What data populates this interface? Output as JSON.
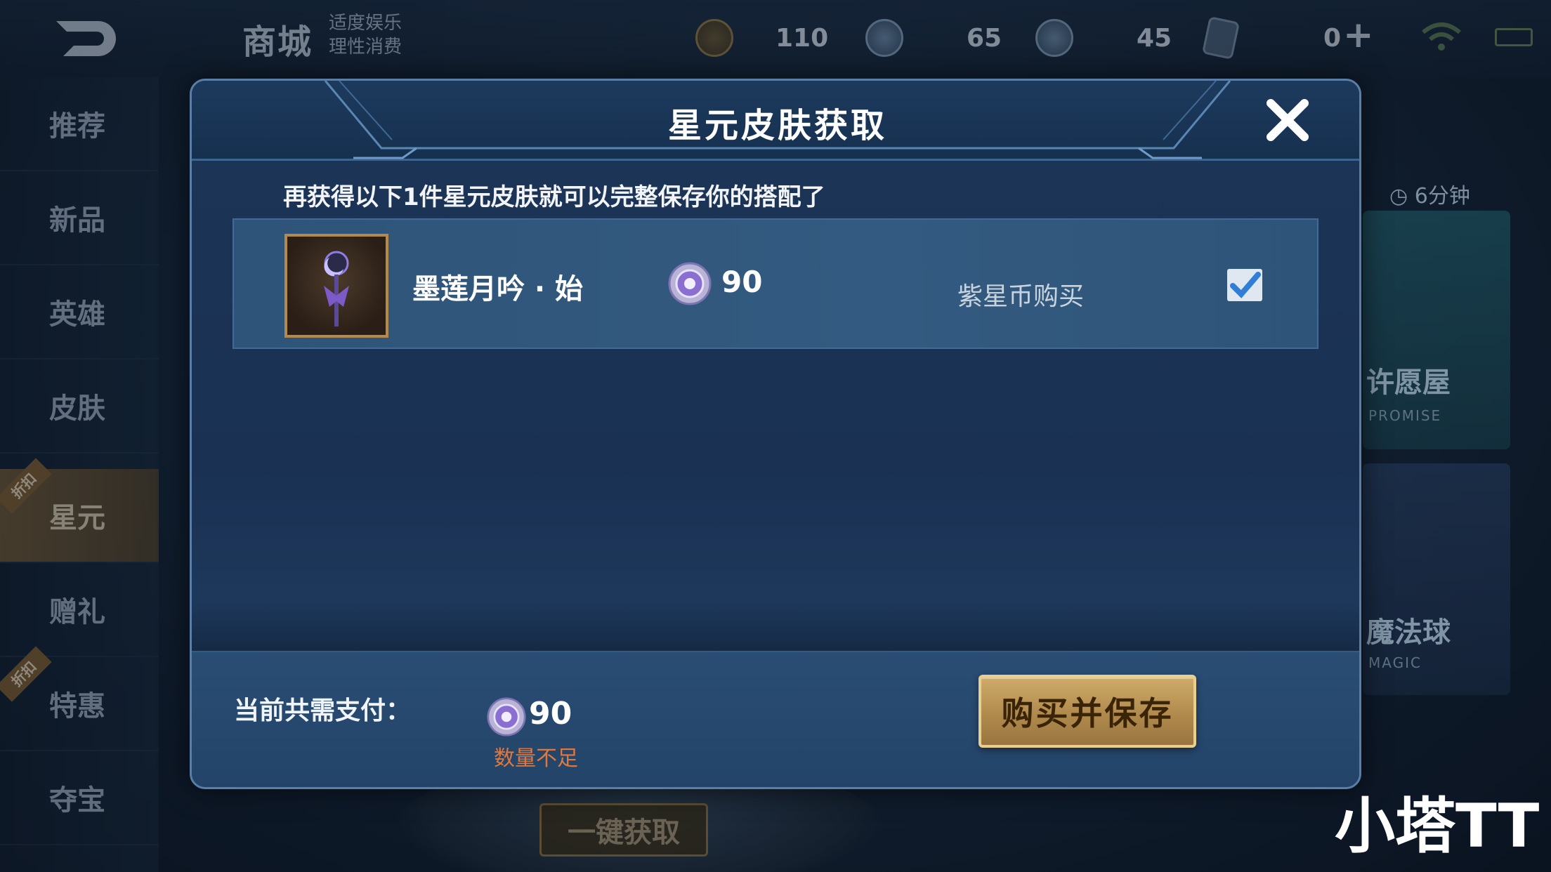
{
  "background": {
    "shop_title": "商城",
    "shop_sub_line1": "适度娱乐",
    "shop_sub_line2": "理性消费",
    "currencies": [
      {
        "name": "coupon",
        "icon": "coupon-icon",
        "value": "110"
      },
      {
        "name": "diamond",
        "icon": "diamond-coin-icon",
        "value": "65"
      },
      {
        "name": "star",
        "icon": "star-coin-icon",
        "value": "45"
      },
      {
        "name": "card",
        "icon": "card-icon",
        "value": "0"
      }
    ],
    "sidebar": [
      {
        "label": "推荐"
      },
      {
        "label": "新品"
      },
      {
        "label": "英雄"
      },
      {
        "label": "皮肤"
      },
      {
        "label": "星元",
        "active": true,
        "tag": "折扣"
      },
      {
        "label": "赠礼"
      },
      {
        "label": "特惠",
        "tag": "折扣"
      },
      {
        "label": "夺宝"
      }
    ],
    "timer": "6分钟",
    "right_panel_label": "许愿屋",
    "right_panel_sub": "PROMISE",
    "right_panel2_label": "魔法球",
    "right_panel2_sub": "MAGIC",
    "bottom_button": "一键获取"
  },
  "modal": {
    "title": "星元皮肤获取",
    "subtitle": "再获得以下1件星元皮肤就可以完整保存你的搭配了",
    "items": [
      {
        "name": "墨莲月吟 · 始",
        "price": "90",
        "pay_method": "紫星币购买",
        "checked": true
      }
    ],
    "footer": {
      "total_label": "当前共需支付：",
      "total_amount": "90",
      "insufficient": "数量不足",
      "buy_button": "购买并保存"
    }
  },
  "watermark": "小塔TT",
  "colors": {
    "accent_gold": "#b08a4c",
    "warning": "#e0783c",
    "panel_blue": "#1c3557"
  }
}
